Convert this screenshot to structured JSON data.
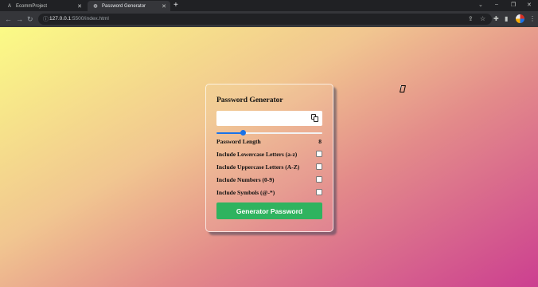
{
  "browser": {
    "tabs": [
      {
        "title": "EcommProject",
        "favicon": "A",
        "active": false
      },
      {
        "title": "Password Generator",
        "favicon": "globe-icon",
        "active": true
      }
    ],
    "url_host": "127.0.0.1",
    "url_path": ":5500/index.html"
  },
  "card": {
    "title": "Password Generator",
    "password_value": "",
    "slider_value": 8,
    "slider_fraction": 0.25,
    "length_label": "Password Length",
    "length_value": "8",
    "options": [
      {
        "label": "Include Lowercase Letters (a-z)",
        "checked": false
      },
      {
        "label": "Include Uppercase Letters (A-Z)",
        "checked": false
      },
      {
        "label": "Include Numbers (0-9)",
        "checked": false
      },
      {
        "label": "Include Symbols (@-*)",
        "checked": false
      }
    ],
    "button_label": "Generator Password"
  },
  "colors": {
    "accent": "#1a73e8",
    "button": "#2fb35f"
  }
}
